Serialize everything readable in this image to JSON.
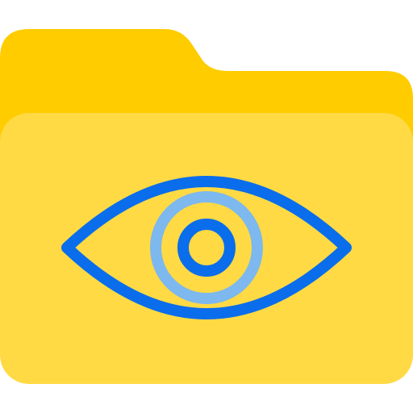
{
  "icon": {
    "name": "folder-eye-icon",
    "parts": [
      "folder-back-icon",
      "folder-front-icon",
      "eye-icon",
      "iris-ring-icon",
      "pupil-icon"
    ]
  },
  "colors": {
    "folder_back": "#FFCC00",
    "folder_front": "#FFDA44",
    "eye_stroke": "#0A6DEB",
    "iris_ring": "#7DB8EE",
    "background": "#FFFFFF"
  }
}
